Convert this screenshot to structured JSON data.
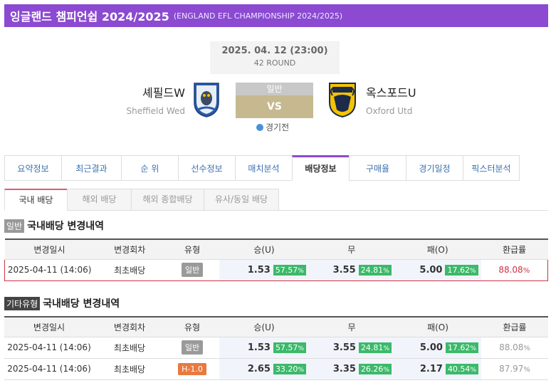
{
  "header": {
    "title_ko": "잉글랜드 챔피언쉽 2024/2025",
    "title_en": "(ENGLAND EFL CHAMPIONSHIP 2024/2025)"
  },
  "match": {
    "datetime": "2025. 04. 12 (23:00)",
    "round": "42 ROUND",
    "home_ko": "셰필드W",
    "home_en": "Sheffield Wed",
    "away_ko": "옥스포드U",
    "away_en": "Oxford Utd",
    "game_type": "일반",
    "vs": "VS",
    "status": "경기전"
  },
  "tabs": [
    "요약정보",
    "최근결과",
    "순 위",
    "선수정보",
    "매치분석",
    "배당정보",
    "구매율",
    "경기일정",
    "픽스터분석"
  ],
  "active_tab": 5,
  "subtabs": [
    "국내 배당",
    "해외 배당",
    "해외 종합배당",
    "유사/동일 배당"
  ],
  "section1": {
    "badge": "일반",
    "title": "국내배당 변경내역"
  },
  "section2": {
    "badge": "기타유형",
    "title": "국내배당 변경내역"
  },
  "columns": [
    "변경일시",
    "변경회차",
    "유형",
    "승(U)",
    "무",
    "패(O)",
    "환급률"
  ],
  "table1": [
    {
      "date": "2025-04-11 (14:06)",
      "round": "최초배당",
      "type": "일반",
      "win": "1.53",
      "win_pct": "57.57",
      "draw": "3.55",
      "draw_pct": "24.81",
      "lose": "5.00",
      "lose_pct": "17.62",
      "refund": "88.08"
    }
  ],
  "table2": [
    {
      "date": "2025-04-11 (14:06)",
      "round": "최초배당",
      "type": "일반",
      "win": "1.53",
      "win_pct": "57.57",
      "draw": "3.55",
      "draw_pct": "24.81",
      "lose": "5.00",
      "lose_pct": "17.62",
      "refund": "88.08"
    },
    {
      "date": "2025-04-11 (14:06)",
      "round": "최초배당",
      "type": "H-1.0",
      "win": "2.65",
      "win_pct": "33.20",
      "draw": "3.35",
      "draw_pct": "26.26",
      "lose": "2.17",
      "lose_pct": "40.54",
      "refund": "87.97"
    }
  ],
  "pct_sign": "%",
  "colors": {
    "accent": "#8b4ad1",
    "pct_green": "#3cb96a",
    "handicap": "#e9793e",
    "highlight_red": "#cc3344",
    "refund_red": "#cc3344"
  }
}
